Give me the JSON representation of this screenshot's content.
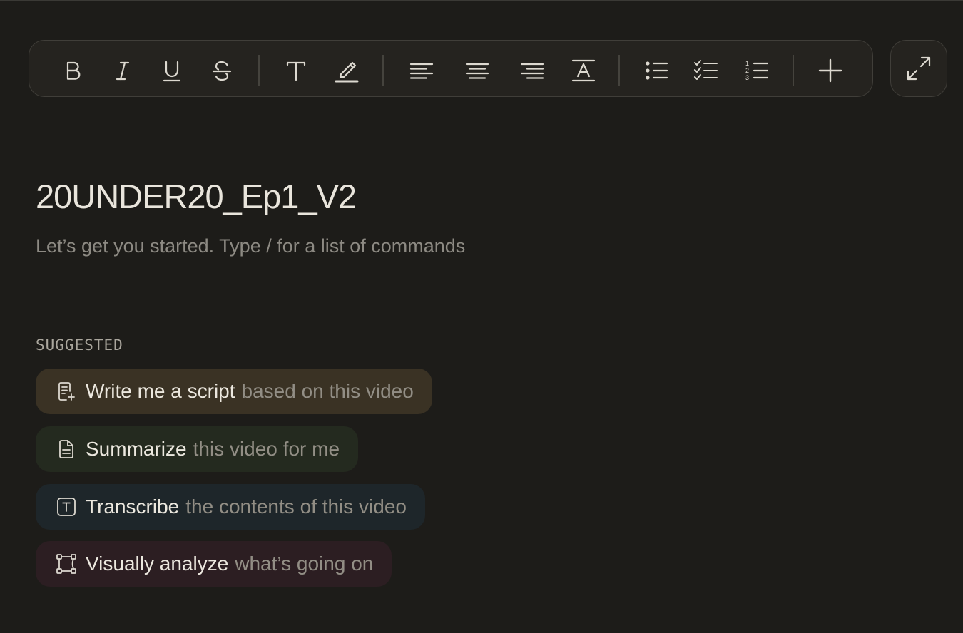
{
  "toolbar": {
    "buttons": [
      {
        "icon": "bold-icon",
        "label": "Bold"
      },
      {
        "icon": "italic-icon",
        "label": "Italic"
      },
      {
        "icon": "underline-icon",
        "label": "Underline"
      },
      {
        "icon": "strikethrough-icon",
        "label": "Strikethrough"
      },
      {
        "icon": "text-style-icon",
        "label": "Text"
      },
      {
        "icon": "highlight-icon",
        "label": "Highlight"
      },
      {
        "icon": "align-left-icon",
        "label": "Align left"
      },
      {
        "icon": "align-center-icon",
        "label": "Align center"
      },
      {
        "icon": "align-right-icon",
        "label": "Align right"
      },
      {
        "icon": "text-color-icon",
        "label": "Text color"
      },
      {
        "icon": "bullet-list-icon",
        "label": "Bulleted list"
      },
      {
        "icon": "checklist-icon",
        "label": "Checklist"
      },
      {
        "icon": "numbered-list-icon",
        "label": "Numbered list"
      },
      {
        "icon": "plus-icon",
        "label": "Insert"
      }
    ],
    "expand_icon": "expand-icon"
  },
  "document": {
    "title": "20UNDER20_Ep1_V2",
    "placeholder": "Let’s get you started. Type / for a list of commands"
  },
  "suggested": {
    "label": "SUGGESTED",
    "items": [
      {
        "icon": "script-icon",
        "main": "Write me a script",
        "rest": "based on this video",
        "color": "#3a3224"
      },
      {
        "icon": "document-icon",
        "main": "Summarize",
        "rest": "this video for me",
        "color": "#242a1f"
      },
      {
        "icon": "transcribe-icon",
        "main": "Transcribe",
        "rest": "the contents of this video",
        "color": "#1e262a"
      },
      {
        "icon": "analyze-icon",
        "main": "Visually analyze",
        "rest": "what’s going on",
        "color": "#2c1e22"
      }
    ]
  },
  "colors": {
    "background": "#1d1c19",
    "toolbar_bg": "#25231f",
    "text_primary": "#e9e5dc",
    "text_muted": "#8d8a83"
  }
}
